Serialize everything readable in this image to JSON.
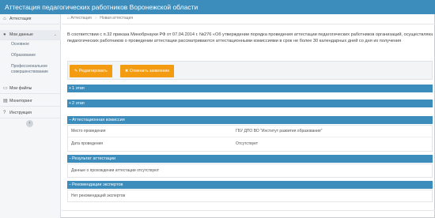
{
  "app": {
    "title": "Аттестация педагогических работников Воронежской области"
  },
  "sidebar": {
    "items": [
      {
        "label": "Аттестация",
        "icon": "home-icon"
      },
      {
        "label": "Мои данные",
        "icon": "user-icon"
      },
      {
        "label": "Мои файлы",
        "icon": "file-icon"
      },
      {
        "label": "Мониторинг",
        "icon": "chart-icon"
      },
      {
        "label": "Инструкция",
        "icon": "question-icon"
      }
    ],
    "subitems": [
      {
        "label": "Основное"
      },
      {
        "label": "Образование"
      },
      {
        "label": "Профессиональное совершенствование"
      }
    ],
    "collapse_icon": "chevron-left-icon"
  },
  "breadcrumb": {
    "root": "Аттестация",
    "current": "Новая аттестация",
    "icon": "home-icon"
  },
  "intro": {
    "line1": "В соответствии с п.32 приказа Минобрнауки РФ от 07.04.2014 г. №276 «Об утверждении порядка проведения аттестации педагогических работников организаций, осуществляющих",
    "line2": "педагогических работников о проведении аттестации рассматриваются аттестационными комиссиями в срок не более 30 календарных дней со дня их получения"
  },
  "buttons": {
    "edit": "Редактировать",
    "cancel": "Отменить заявление"
  },
  "sections": {
    "stage1": "1 этап",
    "stage2": "2 этап",
    "commission": "Аттестационная комиссия",
    "result": "Результат аттестации",
    "recommendations": "Рекомендации экспертов"
  },
  "commission": {
    "place_label": "Место проведения",
    "place_value": "ГБУ ДПО ВО \"Институт развития образования\"",
    "date_label": "Дата проведения",
    "date_value": "Отсутствует"
  },
  "result": {
    "text": "Данные о прохождении аттестации отсутствуют"
  },
  "recommendations": {
    "text": "Нет рекомендаций экспертов"
  },
  "colors": {
    "header": "#3c8dbc",
    "accent": "#f39c12"
  }
}
